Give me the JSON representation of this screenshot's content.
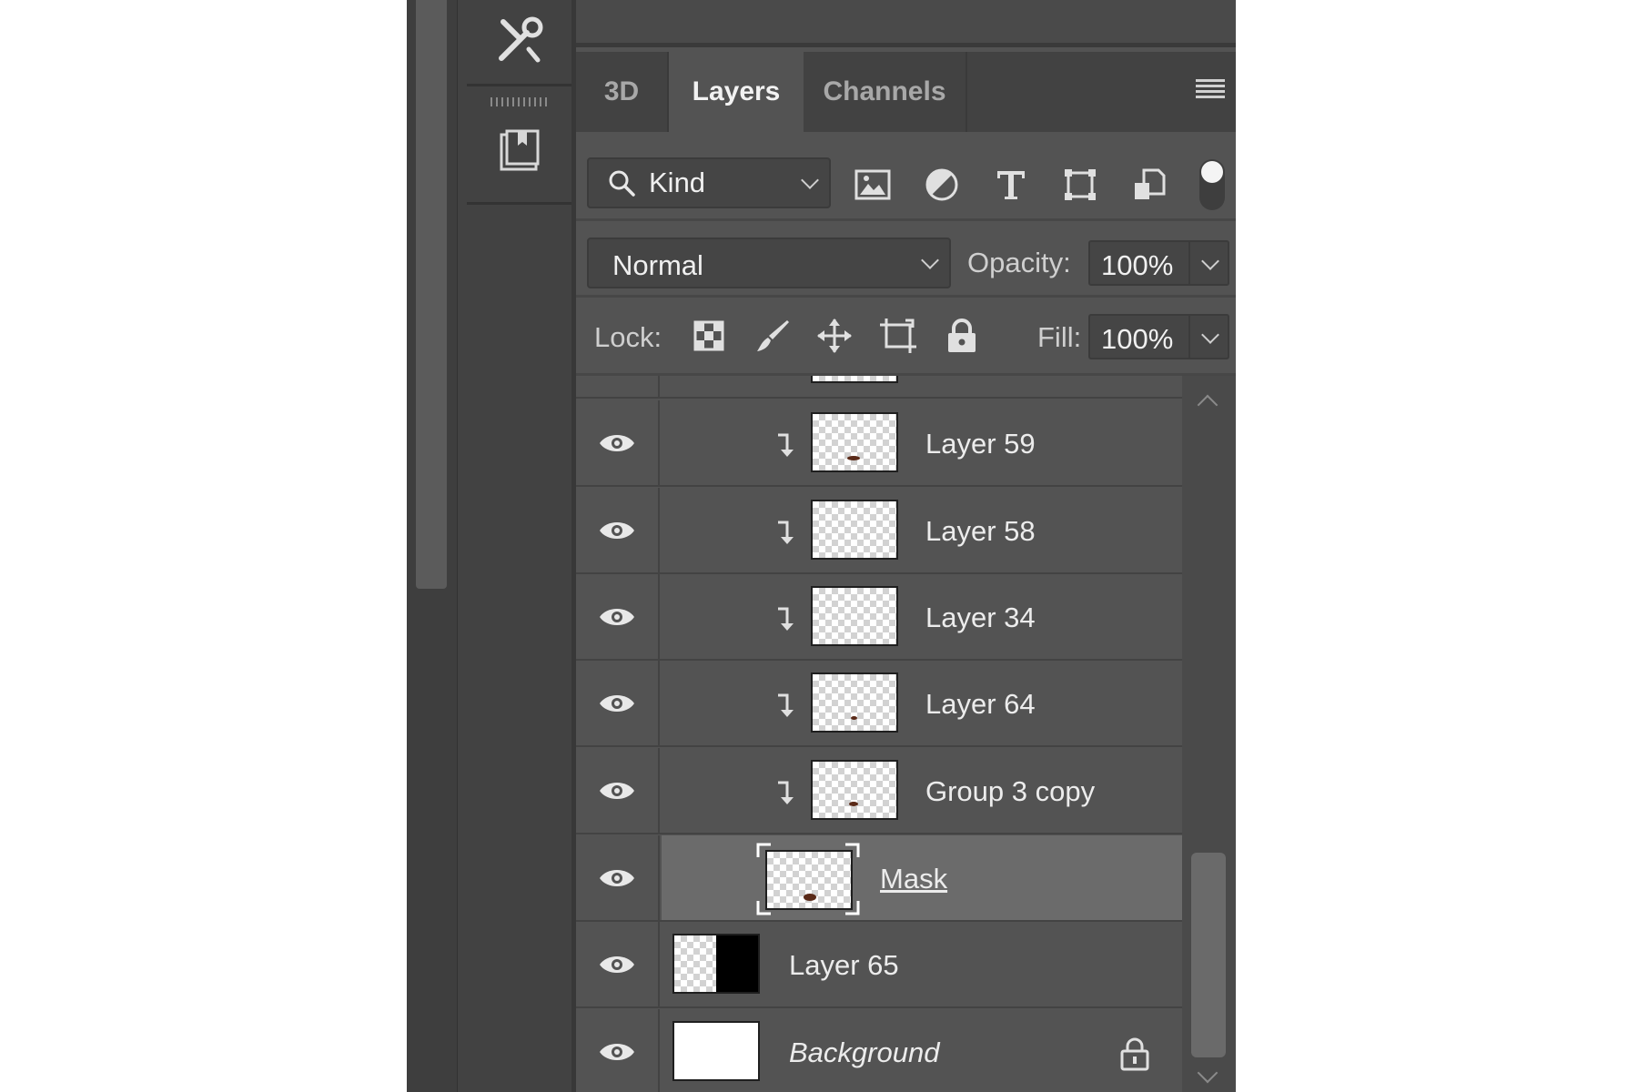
{
  "tabs": [
    {
      "label": "3D",
      "active": false
    },
    {
      "label": "Layers",
      "active": true
    },
    {
      "label": "Channels",
      "active": false
    }
  ],
  "filter": {
    "kind_label": "Kind",
    "icons": [
      "image-filter-icon",
      "adjustment-filter-icon",
      "type-filter-icon",
      "shape-filter-icon",
      "smart-object-filter-icon"
    ]
  },
  "blend": {
    "mode": "Normal",
    "opacity_label": "Opacity:",
    "opacity_value": "100%"
  },
  "lock": {
    "label": "Lock:",
    "fill_label": "Fill:",
    "fill_value": "100%"
  },
  "layers": [
    {
      "name": "Layer 59",
      "clipped": true
    },
    {
      "name": "Layer 58",
      "clipped": true
    },
    {
      "name": "Layer 34",
      "clipped": true
    },
    {
      "name": "Layer 64",
      "clipped": true
    },
    {
      "name": "Group 3 copy",
      "clipped": true
    },
    {
      "name": "Mask",
      "selected": true
    },
    {
      "name": "Layer 65",
      "has_mask": true
    },
    {
      "name": "Background",
      "locked": true
    }
  ],
  "colors": {
    "panel_bg": "#535353",
    "selected_row": "#6b6b6b",
    "tab_bar": "#424242"
  }
}
